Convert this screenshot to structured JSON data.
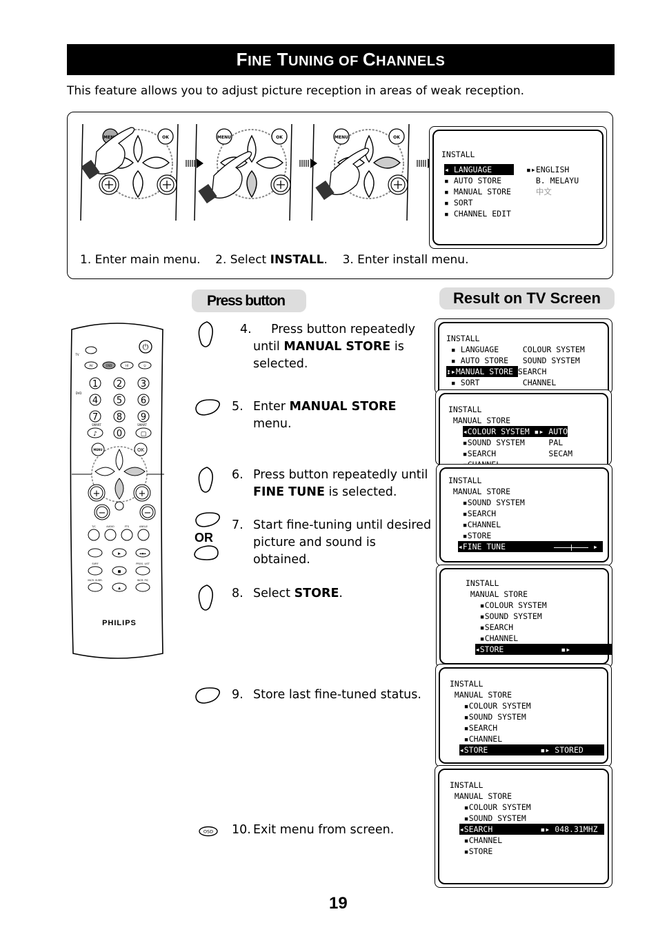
{
  "page": {
    "title": "Fine Tuning of Channels",
    "intro": "This feature allows you to adjust picture reception in areas of weak reception.",
    "page_number": "19"
  },
  "top_panel": {
    "captions": [
      {
        "text": "1. Enter main menu."
      },
      {
        "pre": "2. Select ",
        "bold": "INSTALL",
        "post": "."
      },
      {
        "text": "3. Enter install menu."
      }
    ],
    "remote_labels": {
      "menu": "MENU",
      "ok": "OK"
    },
    "install_screen": {
      "title": "INSTALL",
      "items": [
        "LANGUAGE",
        "AUTO STORE",
        "MANUAL STORE",
        "SORT",
        "CHANNEL EDIT"
      ],
      "selected": "LANGUAGE",
      "options": [
        "ENGLISH",
        "B. MELAYU",
        "中文"
      ]
    }
  },
  "headers": {
    "press_button": "Press button",
    "result": "Result on TV Screen"
  },
  "steps": [
    {
      "num": "4.",
      "pre": "Press button repeatedly until ",
      "bold": "MANUAL STORE",
      "post": " is selected.",
      "button_icon": "nav-up-down-button"
    },
    {
      "num": "5.",
      "pre": "Enter ",
      "bold": "MANUAL STORE",
      "post": " menu.",
      "button_icon": "nav-right-button"
    },
    {
      "num": "6.",
      "pre": "Press button repeatedly until ",
      "bold": "FINE TUNE",
      "post": " is selected.",
      "button_icon": "nav-up-down-button"
    },
    {
      "num": "7.",
      "pre": "Start fine-tuning until desired picture and sound is obtained.",
      "bold": "",
      "post": "",
      "button_icon": "nav-left-right-button",
      "or_label": "OR"
    },
    {
      "num": "8.",
      "pre": "Select ",
      "bold": "STORE",
      "post": ".",
      "button_icon": "nav-up-down-button"
    },
    {
      "num": "9.",
      "pre": "Store last fine-tuned status.",
      "bold": "",
      "post": "",
      "button_icon": "nav-right-button"
    },
    {
      "num": "10.",
      "pre": "Exit menu from screen.",
      "bold": "",
      "post": "",
      "button_icon": "osd-button",
      "osd_label": "OSD"
    }
  ],
  "tv_screens": [
    {
      "lines": [
        "INSTALL",
        "",
        " ▪ LANGUAGE     COLOUR SYSTEM",
        " ▪ AUTO STORE   SOUND SYSTEM",
        "↕▸MANUAL STORE SEARCH",
        " ▪ SORT         CHANNEL"
      ],
      "highlight": "MANUAL STORE"
    },
    {
      "lines": [
        "INSTALL",
        " MANUAL STORE",
        "   ◂COLOUR SYSTEM ▪▸ AUTO",
        "   ▪SOUND SYSTEM     PAL",
        "   ▪SEARCH           SECAM",
        "   ▪CHANNEL"
      ]
    },
    {
      "lines": [
        "INSTALL",
        " MANUAL STORE",
        "   ▪SOUND SYSTEM",
        "   ▪SEARCH",
        "   ▪CHANNEL",
        "   ▪STORE",
        "  ◂FINE TUNE"
      ],
      "fine_tune_level": 0.5
    },
    {
      "lines": [
        "INSTALL",
        " MANUAL STORE",
        "   ▪COLOUR SYSTEM",
        "   ▪SOUND SYSTEM",
        "   ▪SEARCH",
        "   ▪CHANNEL",
        "  ◂STORE            ▪▸"
      ]
    },
    {
      "lines": [
        "INSTALL",
        " MANUAL STORE",
        "   ▪COLOUR SYSTEM",
        "   ▪SOUND SYSTEM",
        "   ▪SEARCH",
        "   ▪CHANNEL",
        "  ◂STORE           ▪▸ STORED"
      ]
    },
    {
      "lines": [
        "INSTALL",
        " MANUAL STORE",
        "   ▪COLOUR SYSTEM",
        "   ▪SOUND SYSTEM",
        "  ◂SEARCH          ▪▸ 048.31MHZ",
        "   ▪CHANNEL",
        "   ▪STORE"
      ]
    }
  ],
  "remote": {
    "brand": "PHILIPS",
    "top_buttons": [
      "AV",
      "OSD",
      "I-II",
      "⏻"
    ],
    "digits": [
      "1",
      "2",
      "3",
      "4",
      "5",
      "6",
      "7",
      "8",
      "9",
      "♪",
      "0",
      "▢"
    ],
    "smart_label": "SMART",
    "side_switch": [
      "TV",
      "DVD"
    ],
    "nav": {
      "menu": "MENU",
      "ok": "OK"
    },
    "func_labels": [
      "T/C",
      "AUDIO",
      "FTS",
      "ANGLE"
    ],
    "lower_labels": [
      "SURF",
      "PROG. LIST",
      "INCR. SURR.",
      "INCR. PIC"
    ]
  }
}
